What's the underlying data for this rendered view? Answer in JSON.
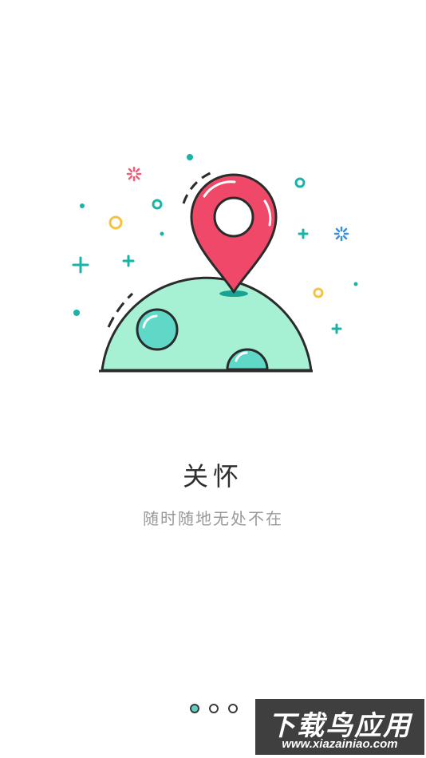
{
  "onboarding": {
    "title": "关怀",
    "subtitle": "随时随地无处不在",
    "page_indicator": {
      "total": 3,
      "active_index": 0
    }
  },
  "illustration": {
    "subject": "location-pin-on-planet",
    "colors": {
      "planet": "#a6f0d4",
      "crater": "#5fd8c8",
      "pin": "#f04868",
      "outline": "#2b2b2b",
      "accent_teal": "#19b3a7",
      "accent_yellow": "#f6c243",
      "accent_blue": "#3a8fe0",
      "accent_pink": "#f25a79"
    }
  },
  "watermark": {
    "top": "下载鸟应用",
    "bottom": "www.xiazainiao.com"
  }
}
